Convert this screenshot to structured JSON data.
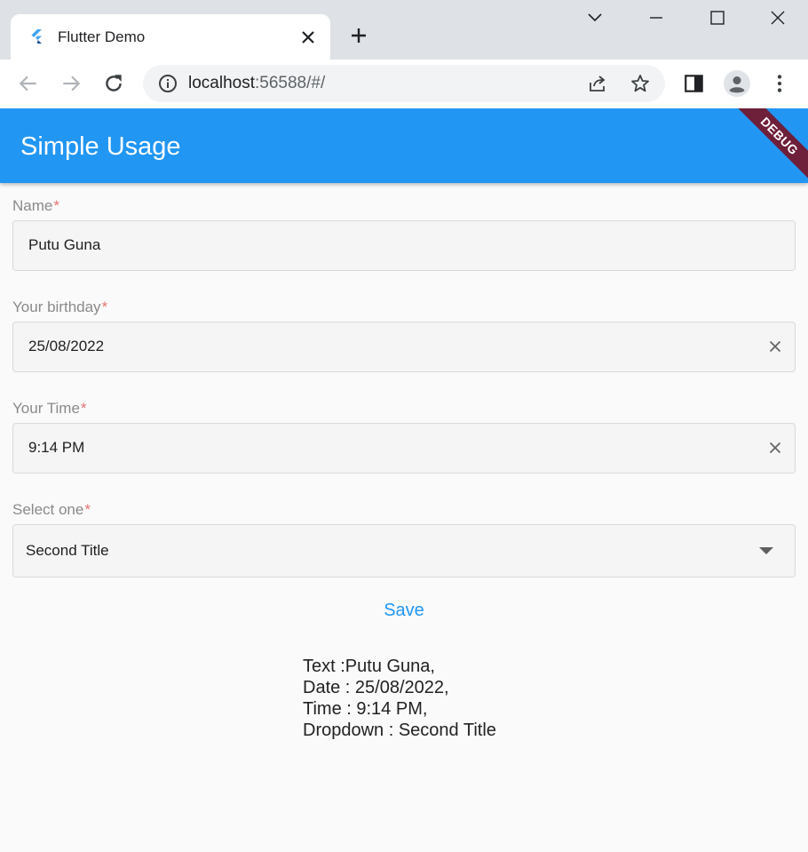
{
  "browser": {
    "tab_title": "Flutter Demo",
    "url_host": "localhost",
    "url_rest": ":56588/#/",
    "icons": [
      "flutter-favicon-icon",
      "close-icon",
      "plus-icon",
      "chevron-down-icon",
      "minimize-icon",
      "maximize-icon",
      "close-window-icon",
      "back-arrow-icon",
      "forward-arrow-icon",
      "reload-icon",
      "info-icon",
      "share-icon",
      "star-icon",
      "side-panel-icon",
      "profile-icon",
      "more-menu-icon"
    ]
  },
  "app": {
    "title": "Simple Usage",
    "debug_banner": "DEBUG",
    "accent_color": "#2196f3",
    "fields": {
      "name": {
        "label": "Name",
        "required": "*",
        "value": "Putu Guna"
      },
      "birthday": {
        "label": "Your birthday",
        "required": "*",
        "value": "25/08/2022"
      },
      "time": {
        "label": "Your Time",
        "required": "*",
        "value": "9:14 PM"
      },
      "select": {
        "label": "Select one",
        "required": "*",
        "value": "Second Title"
      }
    },
    "save_label": "Save",
    "result": {
      "line1": "Text :Putu Guna,",
      "line2": "Date : 25/08/2022,",
      "line3": "Time : 9:14 PM,",
      "line4": "Dropdown : Second Title"
    }
  }
}
